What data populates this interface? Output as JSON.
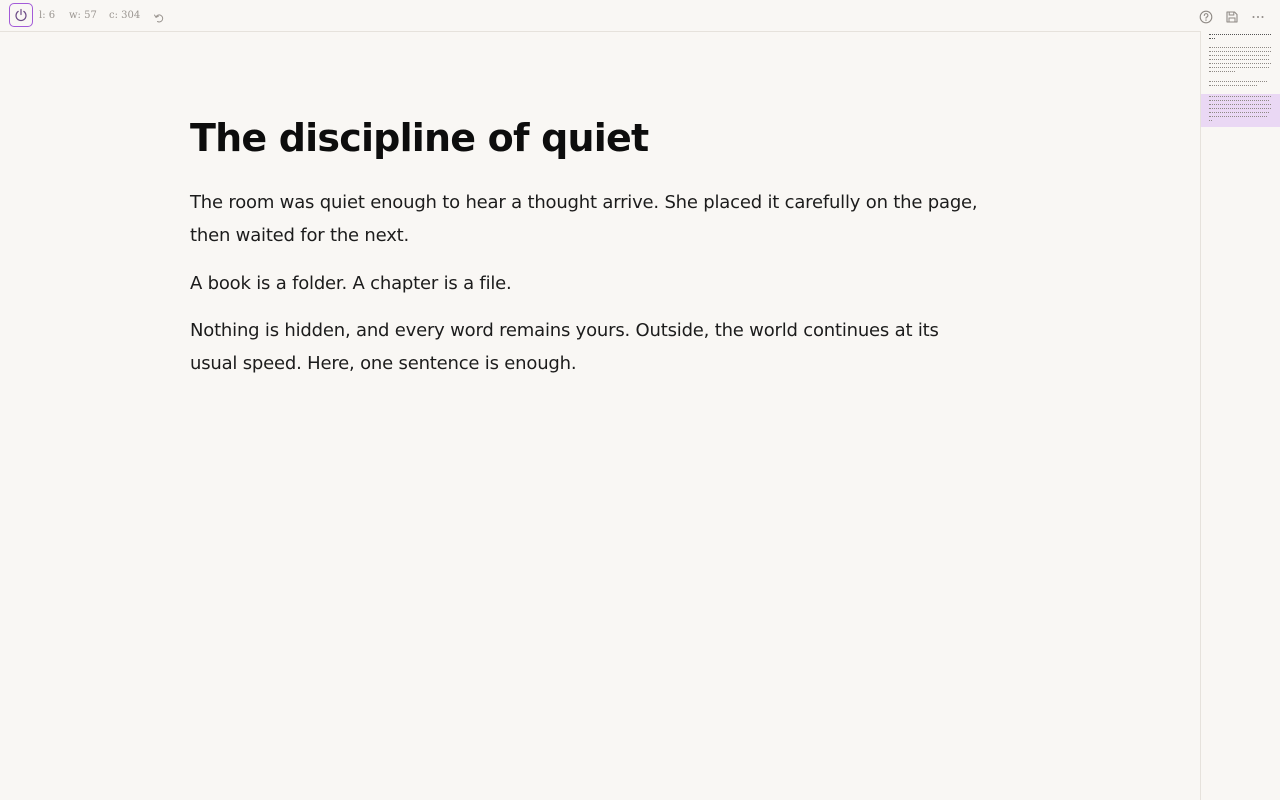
{
  "toolbar": {
    "lines": "l: 6",
    "words": "w: 57",
    "chars": "c: 304"
  },
  "document": {
    "title": "The discipline of quiet",
    "paragraphs": [
      "The room was quiet enough to hear a thought arrive. She placed it carefully on the page, then waited for the next.",
      "A book is a folder. A chapter is a file.",
      "Nothing is hidden, and every word remains yours. Outside, the world continues at its usual speed. Here, one sentence is enough."
    ]
  },
  "colors": {
    "accent": "#a35bd8",
    "background": "#f9f7f4",
    "minimap_highlight": "#ead8f4"
  },
  "icons": [
    "power-icon",
    "undo-icon",
    "help-icon",
    "save-icon",
    "more-icon"
  ]
}
